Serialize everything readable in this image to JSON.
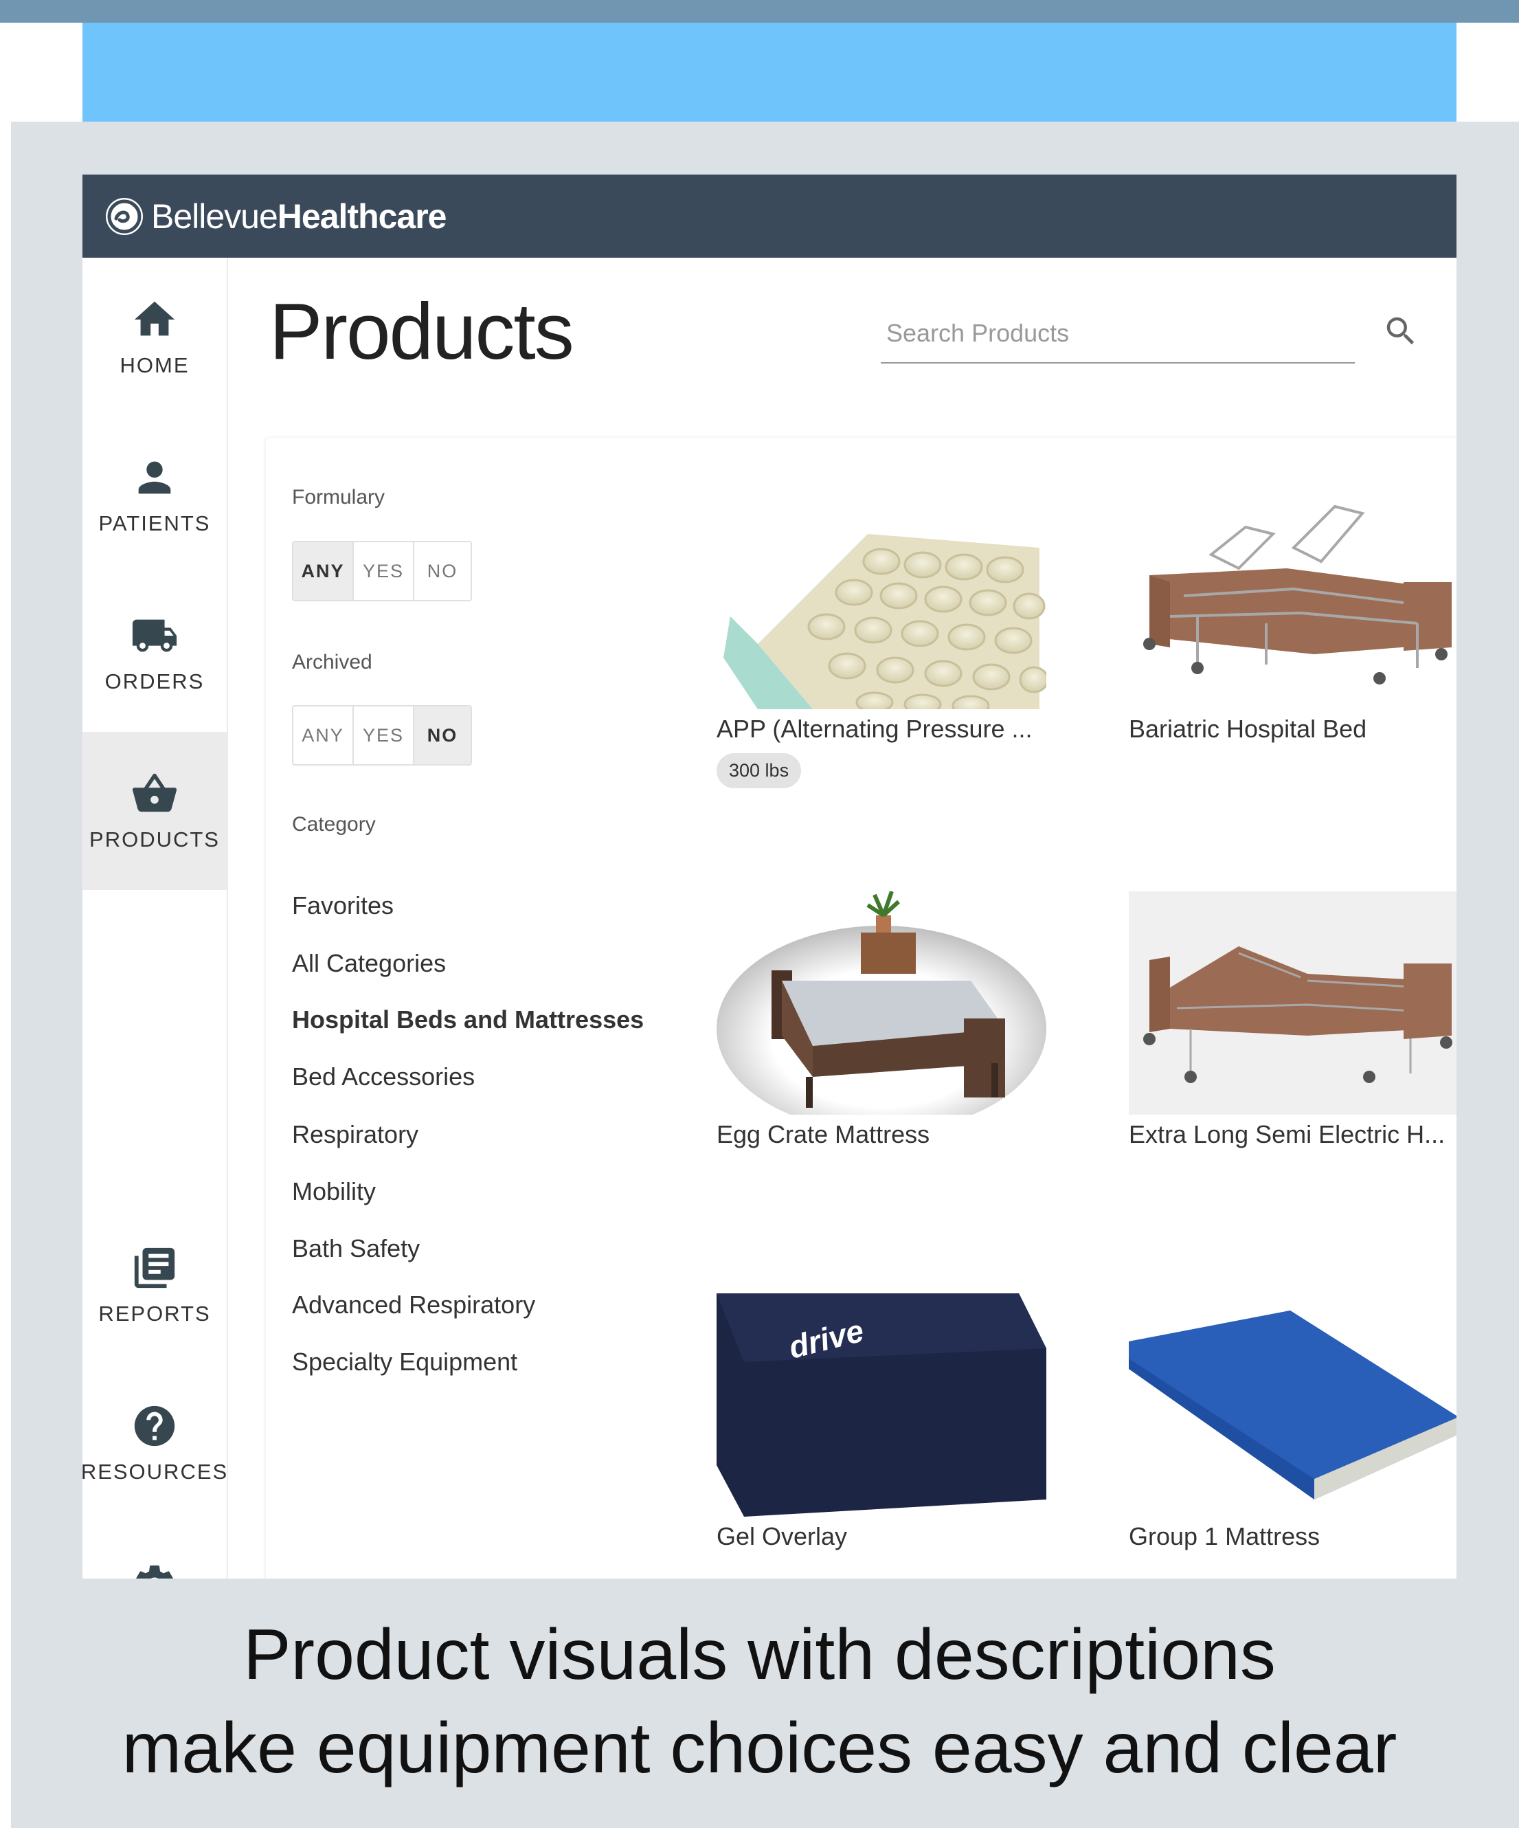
{
  "brand": {
    "part1": "Bellevue",
    "part2": "Healthcare"
  },
  "nav": [
    {
      "label": "HOME",
      "icon": "home-icon"
    },
    {
      "label": "PATIENTS",
      "icon": "person-icon"
    },
    {
      "label": "ORDERS",
      "icon": "truck-icon"
    },
    {
      "label": "PRODUCTS",
      "icon": "basket-icon"
    },
    {
      "label": "REPORTS",
      "icon": "reports-icon"
    },
    {
      "label": "RESOURCES",
      "icon": "help-icon"
    }
  ],
  "page": {
    "title": "Products"
  },
  "search": {
    "placeholder": "Search Products",
    "value": ""
  },
  "filters": {
    "formulary": {
      "label": "Formulary",
      "options": [
        "ANY",
        "YES",
        "NO"
      ],
      "selected": "ANY"
    },
    "archived": {
      "label": "Archived",
      "options": [
        "ANY",
        "YES",
        "NO"
      ],
      "selected": "NO"
    },
    "category": {
      "label": "Category",
      "items": [
        "Favorites",
        "All Categories",
        "Hospital Beds and Mattresses",
        "Bed Accessories",
        "Respiratory",
        "Mobility",
        "Bath Safety",
        "Advanced Respiratory",
        "Specialty Equipment"
      ],
      "selected": "Hospital Beds and Mattresses"
    }
  },
  "products": [
    {
      "name": "APP (Alternating Pressure ...",
      "chip": "300 lbs"
    },
    {
      "name": "Bariatric Hospital Bed"
    },
    {
      "name": "Egg Crate Mattress"
    },
    {
      "name": "Extra Long Semi Electric H..."
    },
    {
      "name": "Gel Overlay",
      "logo": "drive"
    },
    {
      "name": "Group 1 Mattress"
    }
  ],
  "caption": {
    "line1": "Product visuals with descriptions",
    "line2": "make equipment choices easy and clear"
  },
  "colors": {
    "appbar": "#3b4a5a",
    "banner": "#6ec4fb",
    "top_strip": "#7096b1",
    "background": "#dce1e5"
  }
}
